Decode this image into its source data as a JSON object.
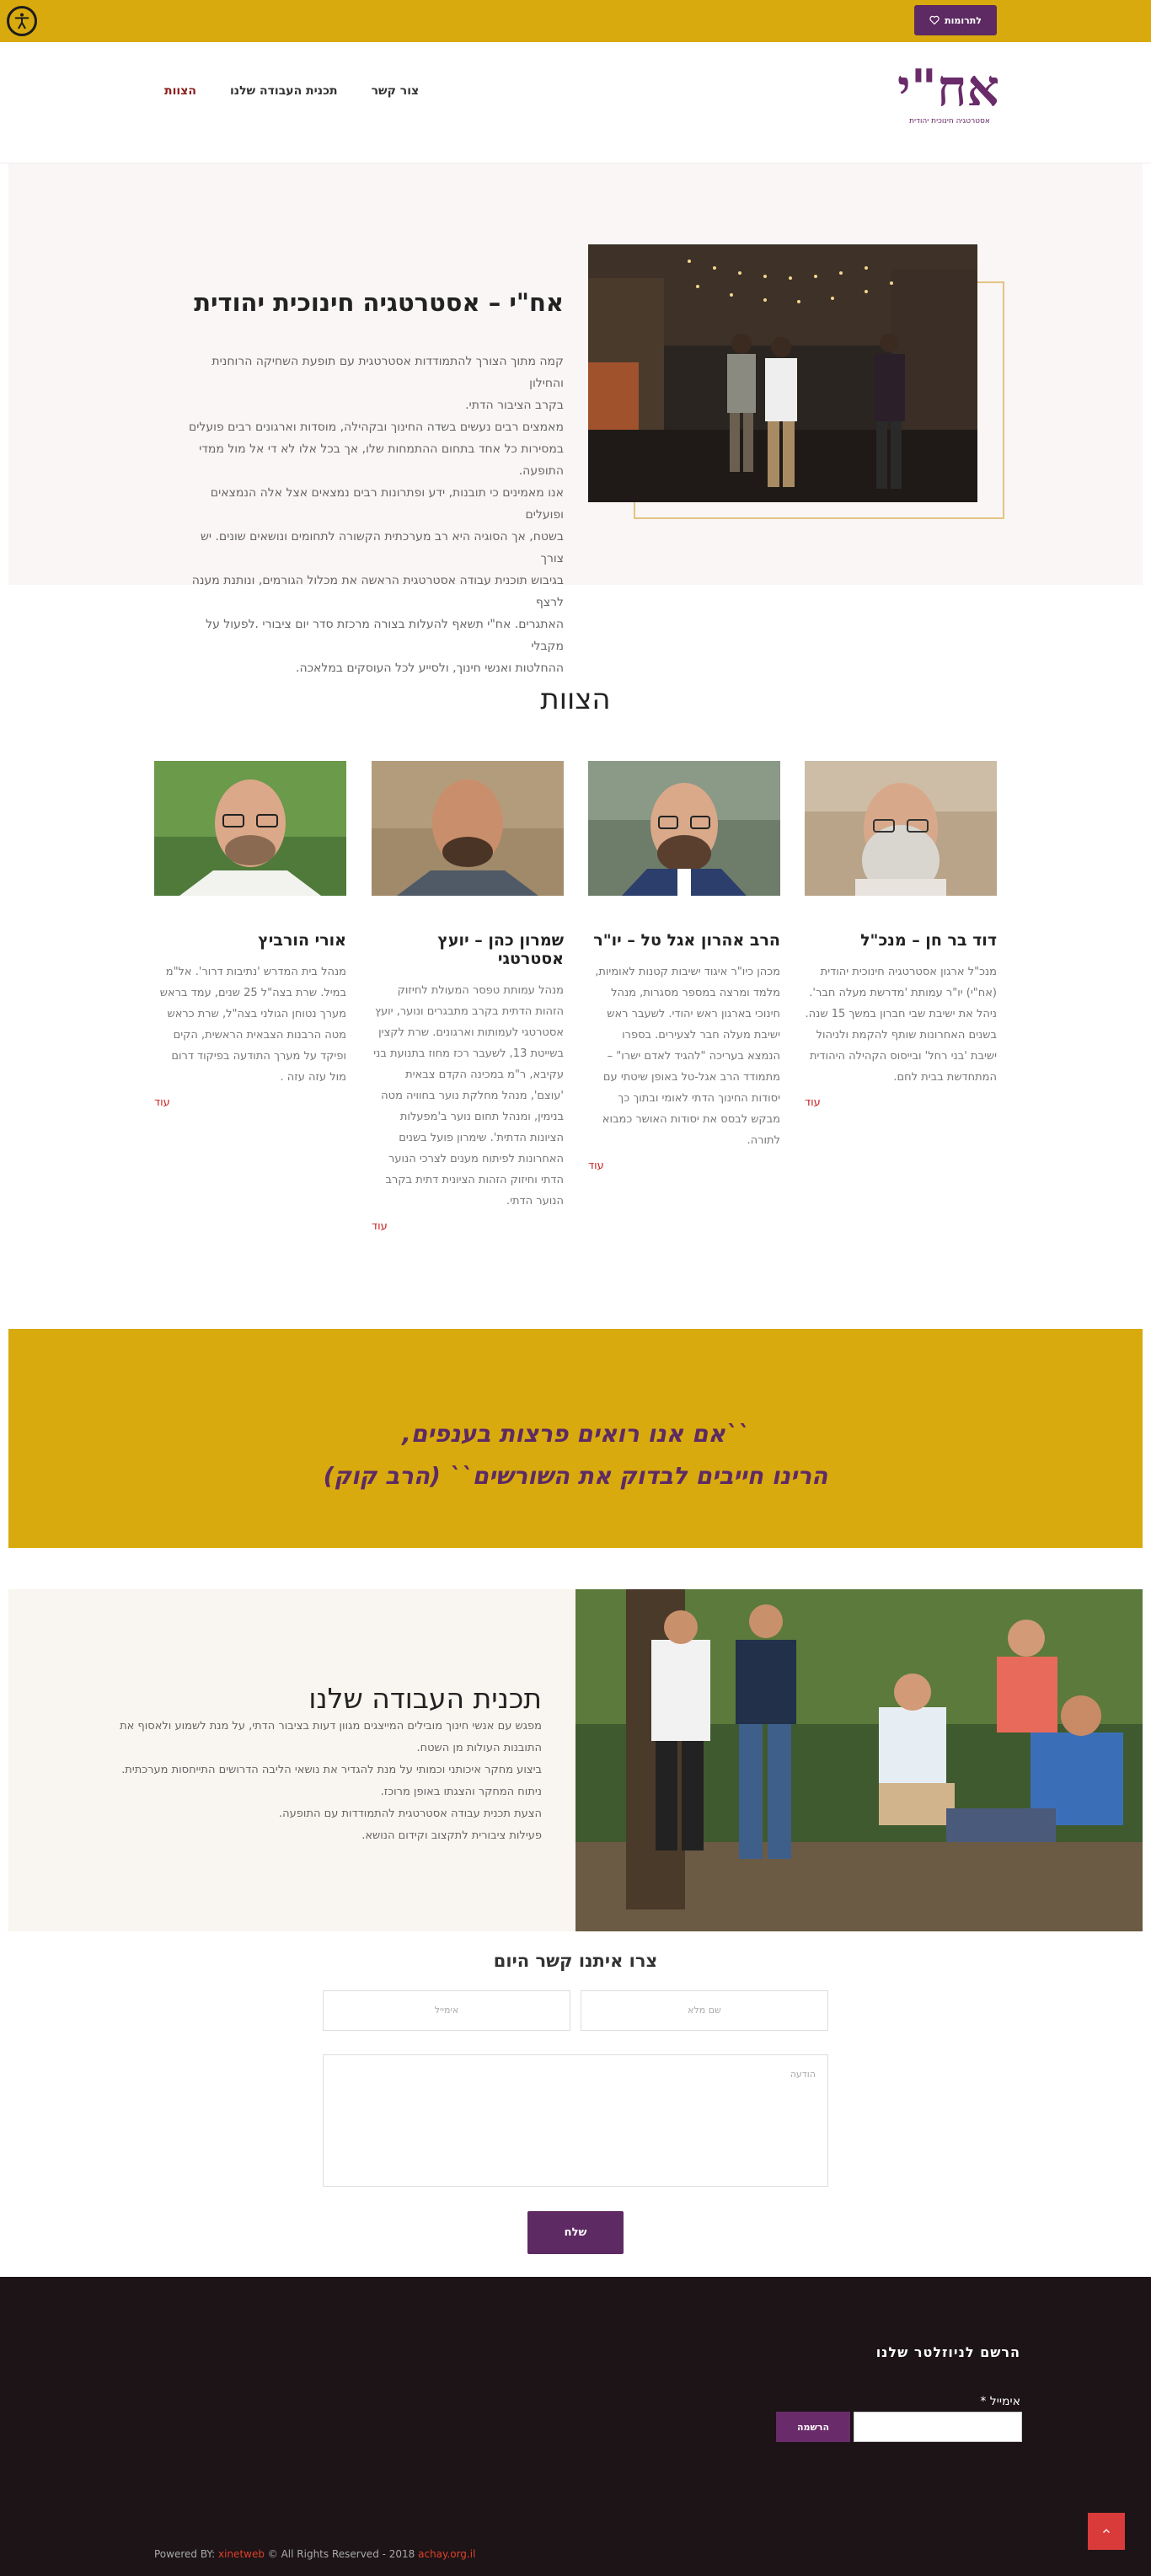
{
  "topbar": {
    "donate_label": "לתרומות",
    "accessibility_icon": "accessibility-icon",
    "heart_icon": "heart-icon"
  },
  "header": {
    "logo_text": "אח\"י",
    "logo_sub": "אסטרטגיה חינוכית יהודית",
    "nav": [
      "צור קשר",
      "תכנית העבודה שלנו",
      "הצוות"
    ],
    "active_nav": "הצוות"
  },
  "hero": {
    "title": "אח\"י – אסטרטגיה חינוכית יהודית",
    "lines": [
      "קמה מתוך הצורך להתמודדות אסטרטגית עם תופעת השחיקה הרוחנית והחילון",
      "בקרב הציבור הדתי.",
      "מאמצים רבים נעשים בשדה החינוך ובקהילה, מוסדות וארגונים רבים פועלים",
      "במסירות כל אחד בתחום ההתמחות שלו, אך בכל אלו לא די אל מול ממדי התופעה.",
      "אנו מאמינים כי תובנות, ידע ופתרונות רבים נמצאים אצל אלה הנמצאים ופועלים",
      "בשטח, אך הסוגיה היא רב מערכתית הקשורה לתחומים ונושאים שונים. יש צורך",
      "בגיבוש תוכנית עבודה אסטרטגית הראשה את מכלול הגורמים, ונותנת מענה לרצף",
      "האתגרים. אח\"י תשאף להעלות בצורה מרכזת סדר יום ציבורי .לפעול על מקבלי",
      "ההחלטות ואנשי חינוך, ולסייע לכל העוסקים במלאכה."
    ]
  },
  "team": {
    "title": "הצוות",
    "more_label": "עוד",
    "members": [
      {
        "name": "דוד בר חן – מנכ\"ל",
        "text": "מנכ\"ל ארגון אסטרטגיה חינוכית יהודית (אח\"י) יו\"ר עמותת 'מדרשת מעלה חבר'. ניהל את ישיבת שבי חברון במשך 15 שנה. בשנים האחרונות שותף להקמת ולניהול ישיבת 'בני רחל' ובייסוס הקהילה היהודית המתחדשת בבית לחם."
      },
      {
        "name": "הרב אהרון אגל טל – יו\"ר",
        "text": "מכהן כיו\"ר איגוד ישיבות קטנות לאומיות, מלמד ומרצה במספר מסגרות, מנהל חינוכי בארגון ראש יהודי. לשעבר ראש ישיבת מעלה חבר לצעירים. בספרו הנמצא בעריכה \"להגיד לאדם ישרו\" – מתמודד הרב אגל-טל באופן שיטתי עם יסודות החינוך הדתי לאומי ובתוך כך מבקש לבסס את יסודות האושר כמבוא לתורה."
      },
      {
        "name": "שמרון כהן – יועץ אסטרטגי",
        "text": "מנהל עמותת טפסר המעולת לחיזוק הזהות הדתית בקרב מתבגרים ונוער, יועץ אסטרטגי לעמותות וארגונים. שרת לקצין בשייטת 13, לשעבר רכז מחוז בתנועת בני עקיבא, ר\"מ במכינה הקדם צבאית 'עוצם', מנהל מחלקת נוער בחוויה מטה בנימין, ומנהל תחום נוער ב'מפעלות הציונות הדתית'. שימרון פועל בשנים האחרונות לפיתוח מענים לצרכי הנוער הדתי וחיזוק הזהות הציונית דתית בקרב הנוער הדתי."
      },
      {
        "name": "אורי הורביץ",
        "text": "מנהל בית המדרש 'נתיבות דרור'. אל\"מ במיל. שרת בצה\"ל 25 שנים, עמד בראש מערך נטוחן הגולני בצה\"ל, שרת כראש מטה הרבנות הצבאית הראשית, הקים ופיקד על מערך התודעה בפיקוד דרום מול עזה עזה ."
      }
    ]
  },
  "quote": {
    "line1": "``אם אנו רואים פרצות בענפים,",
    "line2": "הרינו חייבים לבדוק את השורשים`` (הרב קוק)"
  },
  "plan": {
    "title": "תכנית העבודה שלנו",
    "lines": [
      "מפגש עם אנשי חינוך מובילים המייצגים מגוון דעות בציבור הדתי, על מנת לשמוע ולאסוף את",
      "התובנות העולות מן השטח.",
      "ביצוע מחקר איכותני וכמותי על מנת להגדיר את נושאי הליבה הדרושים התייחסות מערכתית.",
      "ניתוח המחקר והצגתו באופן מרוכז.",
      "הצעת תכנית עבודה אסטרטגית להתמודדות עם התופעה.",
      "פעילות ציבורית לתקצוב וקידום הנושא."
    ]
  },
  "contact": {
    "title": "צרו איתנו קשר היום",
    "name_placeholder": "שם מלא",
    "email_placeholder": "אימייל",
    "message_placeholder": "הודעה",
    "send_label": "שלח"
  },
  "footer": {
    "newsletter_title": "הרשם לניוזלטר שלנו",
    "email_label": "אימייל *",
    "subscribe_label": "הרשמה",
    "copy_prefix": "Powered BY: ",
    "copy_link1": "xinetweb",
    "copy_middle": " © All Rights Reserved - 2018 ",
    "copy_link2": "achay.org.il"
  }
}
